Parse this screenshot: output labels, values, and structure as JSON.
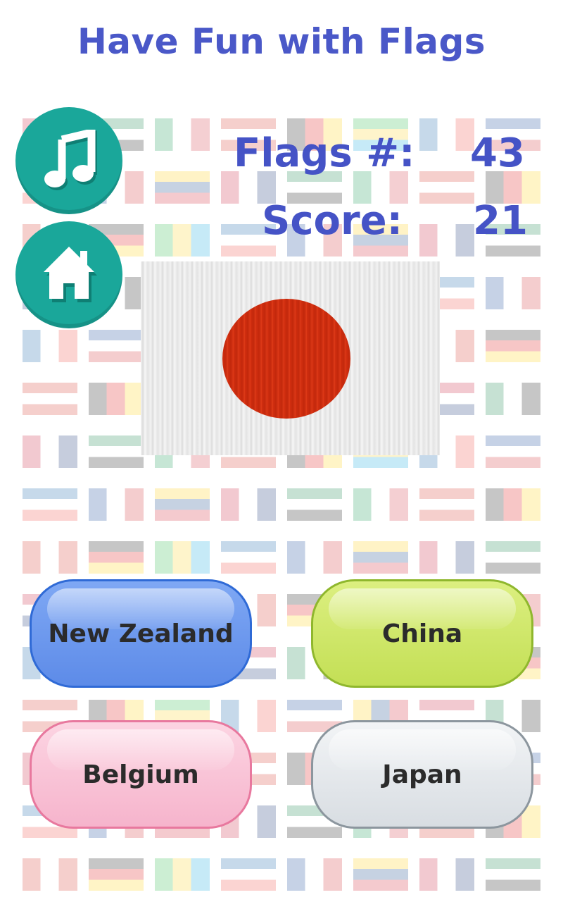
{
  "header": {
    "title": "Have Fun with Flags"
  },
  "controls": {
    "music_icon": "music-note-icon",
    "home_icon": "home-icon",
    "accent_color": "#1aa79a"
  },
  "stats": {
    "flags_label": "Flags #:",
    "flags_value": "43",
    "score_label": "Score:",
    "score_value": "21",
    "color": "#4553c6"
  },
  "question": {
    "flag_colors": {
      "field": "#f2f2f2",
      "disc": "#d22f10"
    }
  },
  "answers": [
    {
      "label": "New Zealand",
      "color": "#6f9af0"
    },
    {
      "label": "China",
      "color": "#cfe56a"
    },
    {
      "label": "Belgium",
      "color": "#f8c3d6"
    },
    {
      "label": "Japan",
      "color": "#e4e8ec"
    }
  ]
}
